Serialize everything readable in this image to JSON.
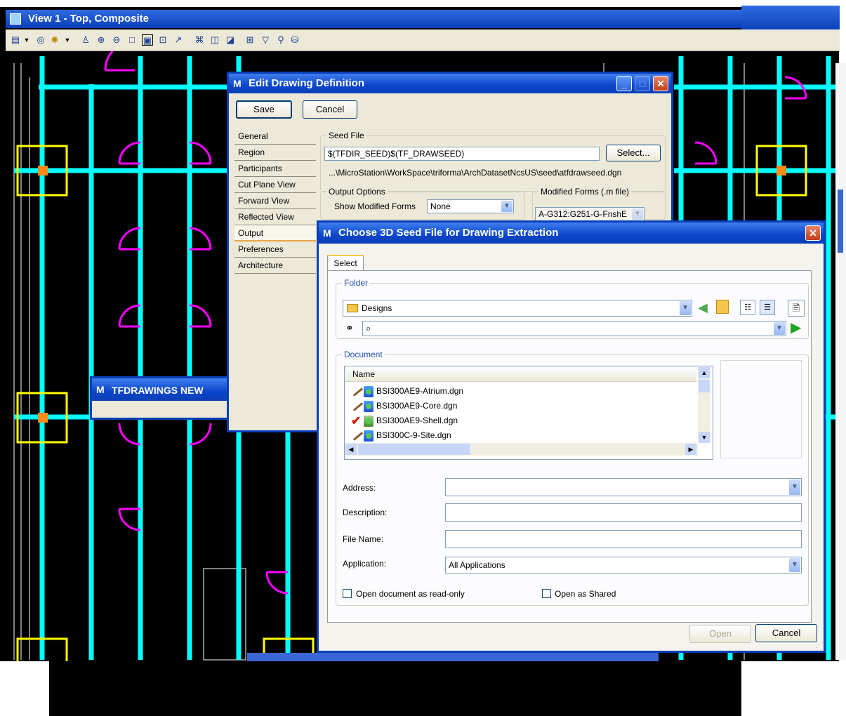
{
  "cad_view": {
    "title": "View 1 - Top, Composite"
  },
  "edit_drawing": {
    "title": "Edit Drawing Definition",
    "save_label": "Save",
    "cancel_label": "Cancel",
    "nav": [
      "General",
      "Region",
      "Participants",
      "Cut Plane View",
      "Forward View",
      "Reflected View",
      "Output",
      "Preferences",
      "Architecture"
    ],
    "active_nav": "Output",
    "seed_file_label": "Seed File",
    "seed_file_value": "$(TFDIR_SEED)$(TF_DRAWSEED)",
    "select_label": "Select...",
    "seed_path": "...\\MicroStation\\WorkSpace\\triforma\\ArchDatasetNcsUS\\seed\\atfdrawseed.dgn",
    "output_options_label": "Output Options",
    "show_modified_forms_label": "Show Modified Forms",
    "show_modified_forms_value": "None",
    "modified_forms_label": "Modified Forms (.m file)",
    "modified_forms_value": "A-G312:G251-G-FnshE"
  },
  "tfdrawings": {
    "title": "TFDRAWINGS NEW"
  },
  "choose_seed": {
    "title": "Choose 3D Seed File for Drawing Extraction",
    "tab": "Select",
    "folder_label": "Folder",
    "folder_value": "Designs",
    "document_label": "Document",
    "list_header": "Name",
    "documents": [
      "BSI300AE9-Atrium.dgn",
      "BSI300AE9-Core.dgn",
      "BSI300AE9-Shell.dgn",
      "BSI300C-9-Site.dgn"
    ],
    "address_label": "Address:",
    "description_label": "Description:",
    "file_name_label": "File Name:",
    "application_label": "Application:",
    "application_value": "All Applications",
    "read_only_label": "Open document as read-only",
    "open_shared_label": "Open as Shared",
    "open_label": "Open",
    "cancel_label": "Cancel"
  },
  "colors": {
    "cad_cyan": "#00ffff",
    "cad_magenta": "#ff00ff",
    "cad_yellow": "#ffff00",
    "xp_blue": "#0a3fb8"
  }
}
